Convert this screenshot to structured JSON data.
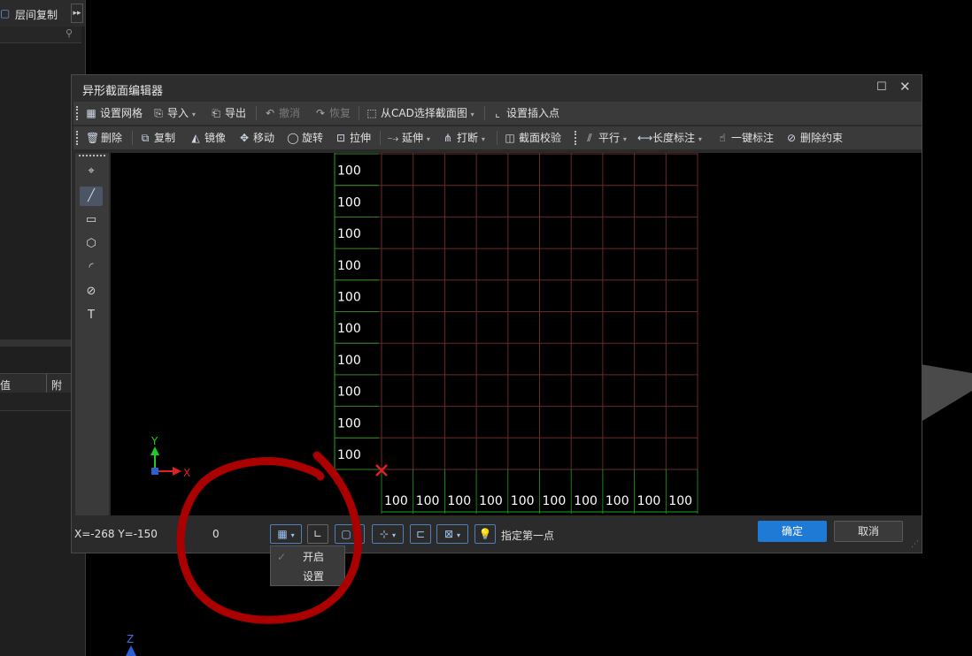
{
  "background": {
    "floor_copy_label": "层间复制",
    "table_col_value": "值",
    "table_col_extra": "附加",
    "z_axis_label": "Z"
  },
  "dialog": {
    "title": "异形截面编辑器",
    "toolbar1": {
      "grid_settings": "设置网格",
      "import": "导入",
      "export": "导出",
      "undo": "撤消",
      "redo": "恢复",
      "select_from_cad": "从CAD选择截面图",
      "set_insert_point": "设置插入点"
    },
    "toolbar2": {
      "delete": "删除",
      "copy": "复制",
      "mirror": "镜像",
      "move": "移动",
      "rotate": "旋转",
      "stretch": "拉伸",
      "extend": "延伸",
      "break": "打断",
      "section_check": "截面校验",
      "parallel": "平行",
      "length_dim": "长度标注",
      "one_click_dim": "一键标注",
      "delete_constraint": "删除约束"
    },
    "canvas": {
      "grid_vertical_labels": [
        "100",
        "100",
        "100",
        "100",
        "100",
        "100",
        "100",
        "100",
        "100",
        "100"
      ],
      "grid_horizontal_labels": [
        "100",
        "100",
        "100",
        "100",
        "100",
        "100",
        "100",
        "100",
        "100",
        "100"
      ],
      "axis_x": "X",
      "axis_y": "Y",
      "colors": {
        "grid": "#6a2a2a",
        "axis": "#1fa31f",
        "marker": "#e02020",
        "text": "#ffffff"
      }
    },
    "status": {
      "coords": "X=-268 Y=-150",
      "value": "0",
      "prompt": "指定第一点",
      "ok": "确定",
      "cancel": "取消"
    },
    "grid_menu": {
      "enable": "开启",
      "settings": "设置"
    }
  }
}
